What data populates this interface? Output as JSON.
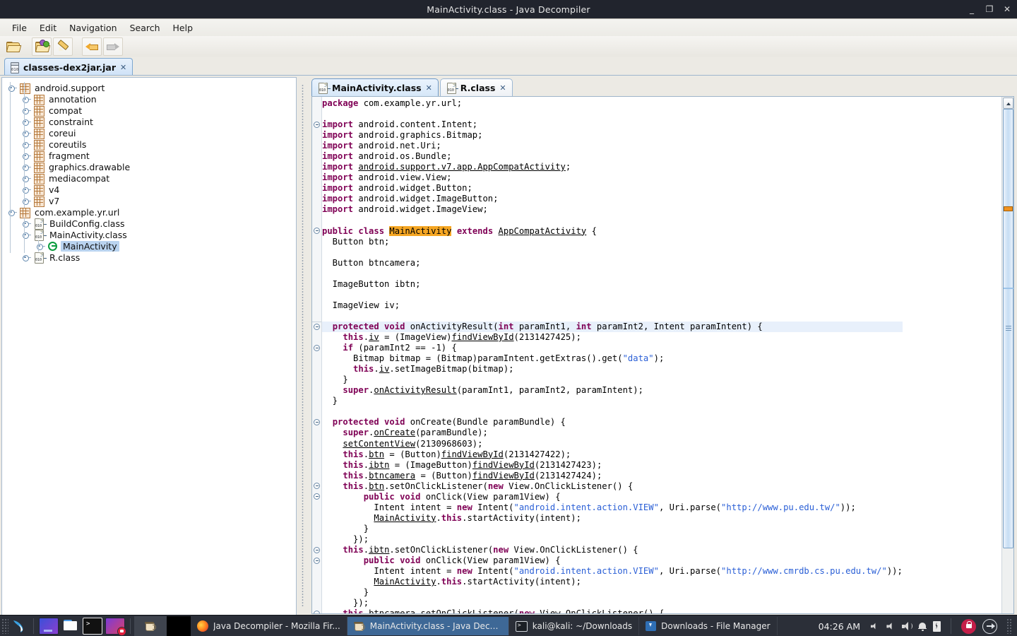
{
  "window": {
    "title": "MainActivity.class - Java Decompiler",
    "controls": [
      {
        "name": "minimize",
        "glyph": "_"
      },
      {
        "name": "maximize",
        "glyph": "❐"
      },
      {
        "name": "close",
        "glyph": "✕"
      }
    ]
  },
  "menubar": {
    "items": [
      "File",
      "Edit",
      "Navigation",
      "Search",
      "Help"
    ]
  },
  "toolbar": {
    "buttons": [
      {
        "name": "open-file-icon",
        "tooltip": "Open File"
      },
      {
        "name": "open-type-icon",
        "tooltip": "Open Type"
      },
      {
        "name": "edit-icon",
        "tooltip": "Edit"
      },
      {
        "name": "back-arrow-icon",
        "tooltip": "Back"
      },
      {
        "name": "forward-arrow-icon",
        "tooltip": "Forward"
      }
    ]
  },
  "jar_tab": {
    "label": "classes-dex2jar.jar",
    "close": "✕"
  },
  "tree": {
    "items": [
      {
        "label": "android.support",
        "indent": 0,
        "icon": "package-icon",
        "expanded": true,
        "selected": false
      },
      {
        "label": "annotation",
        "indent": 1,
        "icon": "package-icon",
        "expanded": false,
        "selected": false
      },
      {
        "label": "compat",
        "indent": 1,
        "icon": "package-icon",
        "expanded": false,
        "selected": false
      },
      {
        "label": "constraint",
        "indent": 1,
        "icon": "package-icon",
        "expanded": false,
        "selected": false
      },
      {
        "label": "coreui",
        "indent": 1,
        "icon": "package-icon",
        "expanded": false,
        "selected": false
      },
      {
        "label": "coreutils",
        "indent": 1,
        "icon": "package-icon",
        "expanded": false,
        "selected": false
      },
      {
        "label": "fragment",
        "indent": 1,
        "icon": "package-icon",
        "expanded": false,
        "selected": false
      },
      {
        "label": "graphics.drawable",
        "indent": 1,
        "icon": "package-icon",
        "expanded": false,
        "selected": false
      },
      {
        "label": "mediacompat",
        "indent": 1,
        "icon": "package-icon",
        "expanded": false,
        "selected": false
      },
      {
        "label": "v4",
        "indent": 1,
        "icon": "package-icon",
        "expanded": false,
        "selected": false
      },
      {
        "label": "v7",
        "indent": 1,
        "icon": "package-icon",
        "expanded": false,
        "selected": false
      },
      {
        "label": "com.example.yr.url",
        "indent": 0,
        "icon": "package-icon",
        "expanded": true,
        "selected": false
      },
      {
        "label": "BuildConfig.class",
        "indent": 1,
        "icon": "class-file-icon",
        "expanded": false,
        "selected": false
      },
      {
        "label": "MainActivity.class",
        "indent": 1,
        "icon": "class-file-icon",
        "expanded": true,
        "selected": false
      },
      {
        "label": "MainActivity",
        "indent": 2,
        "icon": "class-type-icon",
        "expanded": false,
        "selected": true
      },
      {
        "label": "R.class",
        "indent": 1,
        "icon": "class-file-icon",
        "expanded": false,
        "selected": false
      }
    ]
  },
  "editor": {
    "tabs": [
      {
        "label": "MainActivity.class",
        "close": "✕",
        "active": true
      },
      {
        "label": "R.class",
        "close": "✕",
        "active": false
      }
    ],
    "highlight_token": "MainActivity",
    "code_lines": [
      {
        "t": "package",
        "segs": [
          {
            "k": "kw",
            "v": "package"
          },
          {
            "v": " com.example.yr.url;"
          }
        ]
      },
      {
        "segs": []
      },
      {
        "fold": true,
        "segs": [
          {
            "k": "kw",
            "v": "import"
          },
          {
            "v": " android.content.Intent;"
          }
        ]
      },
      {
        "segs": [
          {
            "k": "kw",
            "v": "import"
          },
          {
            "v": " android.graphics.Bitmap;"
          }
        ]
      },
      {
        "segs": [
          {
            "k": "kw",
            "v": "import"
          },
          {
            "v": " android.net.Uri;"
          }
        ]
      },
      {
        "segs": [
          {
            "k": "kw",
            "v": "import"
          },
          {
            "v": " android.os.Bundle;"
          }
        ]
      },
      {
        "segs": [
          {
            "k": "kw",
            "v": "import"
          },
          {
            "v": " "
          },
          {
            "k": "und",
            "v": "android.support.v7.app.AppCompatActivity"
          },
          {
            "v": ";"
          }
        ]
      },
      {
        "segs": [
          {
            "k": "kw",
            "v": "import"
          },
          {
            "v": " android.view.View;"
          }
        ]
      },
      {
        "segs": [
          {
            "k": "kw",
            "v": "import"
          },
          {
            "v": " android.widget.Button;"
          }
        ]
      },
      {
        "segs": [
          {
            "k": "kw",
            "v": "import"
          },
          {
            "v": " android.widget.ImageButton;"
          }
        ]
      },
      {
        "segs": [
          {
            "k": "kw",
            "v": "import"
          },
          {
            "v": " android.widget.ImageView;"
          }
        ]
      },
      {
        "segs": []
      },
      {
        "fold": true,
        "segs": [
          {
            "k": "kw",
            "v": "public class"
          },
          {
            "v": " "
          },
          {
            "k": "mark",
            "v": "MainActivity"
          },
          {
            "v": " "
          },
          {
            "k": "kw",
            "v": "extends"
          },
          {
            "v": " "
          },
          {
            "k": "und",
            "v": "AppCompatActivity"
          },
          {
            "v": " {"
          }
        ]
      },
      {
        "segs": [
          {
            "v": "  Button btn;"
          }
        ]
      },
      {
        "segs": []
      },
      {
        "segs": [
          {
            "v": "  Button btncamera;"
          }
        ]
      },
      {
        "segs": []
      },
      {
        "segs": [
          {
            "v": "  ImageButton ibtn;"
          }
        ]
      },
      {
        "segs": []
      },
      {
        "segs": [
          {
            "v": "  ImageView iv;"
          }
        ]
      },
      {
        "segs": []
      },
      {
        "fold": true,
        "hl": true,
        "segs": [
          {
            "v": "  "
          },
          {
            "k": "kw",
            "v": "protected void"
          },
          {
            "v": " onActivityResult("
          },
          {
            "k": "kw",
            "v": "int"
          },
          {
            "v": " paramInt1, "
          },
          {
            "k": "kw",
            "v": "int"
          },
          {
            "v": " paramInt2, Intent paramIntent) {"
          }
        ]
      },
      {
        "segs": [
          {
            "v": "    "
          },
          {
            "k": "kw",
            "v": "this"
          },
          {
            "v": "."
          },
          {
            "k": "und",
            "v": "iv"
          },
          {
            "v": " = (ImageView)"
          },
          {
            "k": "und",
            "v": "findViewById"
          },
          {
            "v": "(2131427425);"
          }
        ]
      },
      {
        "fold": true,
        "segs": [
          {
            "v": "    "
          },
          {
            "k": "kw",
            "v": "if"
          },
          {
            "v": " (paramInt2 == -1) {"
          }
        ]
      },
      {
        "segs": [
          {
            "v": "      Bitmap bitmap = (Bitmap)paramIntent.getExtras().get("
          },
          {
            "k": "str",
            "v": "\"data\""
          },
          {
            "v": ");"
          }
        ]
      },
      {
        "segs": [
          {
            "v": "      "
          },
          {
            "k": "kw",
            "v": "this"
          },
          {
            "v": "."
          },
          {
            "k": "und",
            "v": "iv"
          },
          {
            "v": ".setImageBitmap(bitmap);"
          }
        ]
      },
      {
        "segs": [
          {
            "v": "    }"
          }
        ]
      },
      {
        "segs": [
          {
            "v": "    "
          },
          {
            "k": "kw",
            "v": "super"
          },
          {
            "v": "."
          },
          {
            "k": "und",
            "v": "onActivityResult"
          },
          {
            "v": "(paramInt1, paramInt2, paramIntent);"
          }
        ]
      },
      {
        "segs": [
          {
            "v": "  }"
          }
        ]
      },
      {
        "segs": []
      },
      {
        "fold": true,
        "segs": [
          {
            "v": "  "
          },
          {
            "k": "kw",
            "v": "protected void"
          },
          {
            "v": " onCreate(Bundle paramBundle) {"
          }
        ]
      },
      {
        "segs": [
          {
            "v": "    "
          },
          {
            "k": "kw",
            "v": "super"
          },
          {
            "v": "."
          },
          {
            "k": "und",
            "v": "onCreate"
          },
          {
            "v": "(paramBundle);"
          }
        ]
      },
      {
        "segs": [
          {
            "v": "    "
          },
          {
            "k": "und",
            "v": "setContentView"
          },
          {
            "v": "(2130968603);"
          }
        ]
      },
      {
        "segs": [
          {
            "v": "    "
          },
          {
            "k": "kw",
            "v": "this"
          },
          {
            "v": "."
          },
          {
            "k": "und",
            "v": "btn"
          },
          {
            "v": " = (Button)"
          },
          {
            "k": "und",
            "v": "findViewById"
          },
          {
            "v": "(2131427422);"
          }
        ]
      },
      {
        "segs": [
          {
            "v": "    "
          },
          {
            "k": "kw",
            "v": "this"
          },
          {
            "v": "."
          },
          {
            "k": "und",
            "v": "ibtn"
          },
          {
            "v": " = (ImageButton)"
          },
          {
            "k": "und",
            "v": "findViewById"
          },
          {
            "v": "(2131427423);"
          }
        ]
      },
      {
        "segs": [
          {
            "v": "    "
          },
          {
            "k": "kw",
            "v": "this"
          },
          {
            "v": "."
          },
          {
            "k": "und",
            "v": "btncamera"
          },
          {
            "v": " = (Button)"
          },
          {
            "k": "und",
            "v": "findViewById"
          },
          {
            "v": "(2131427424);"
          }
        ]
      },
      {
        "fold": true,
        "segs": [
          {
            "v": "    "
          },
          {
            "k": "kw",
            "v": "this"
          },
          {
            "v": "."
          },
          {
            "k": "und",
            "v": "btn"
          },
          {
            "v": ".setOnClickListener("
          },
          {
            "k": "kw",
            "v": "new"
          },
          {
            "v": " View.OnClickListener() {"
          }
        ]
      },
      {
        "fold": true,
        "segs": [
          {
            "v": "        "
          },
          {
            "k": "kw",
            "v": "public void"
          },
          {
            "v": " onClick(View param1View) {"
          }
        ]
      },
      {
        "segs": [
          {
            "v": "          Intent intent = "
          },
          {
            "k": "kw",
            "v": "new"
          },
          {
            "v": " Intent("
          },
          {
            "k": "str",
            "v": "\"android.intent.action.VIEW\""
          },
          {
            "v": ", Uri.parse("
          },
          {
            "k": "str",
            "v": "\"http://www.pu.edu.tw/\""
          },
          {
            "v": "));"
          }
        ]
      },
      {
        "segs": [
          {
            "v": "          "
          },
          {
            "k": "und",
            "v": "MainActivity"
          },
          {
            "v": "."
          },
          {
            "k": "kw",
            "v": "this"
          },
          {
            "v": ".startActivity(intent);"
          }
        ]
      },
      {
        "segs": [
          {
            "v": "        }"
          }
        ]
      },
      {
        "segs": [
          {
            "v": "      });"
          }
        ]
      },
      {
        "fold": true,
        "segs": [
          {
            "v": "    "
          },
          {
            "k": "kw",
            "v": "this"
          },
          {
            "v": "."
          },
          {
            "k": "und",
            "v": "ibtn"
          },
          {
            "v": ".setOnClickListener("
          },
          {
            "k": "kw",
            "v": "new"
          },
          {
            "v": " View.OnClickListener() {"
          }
        ]
      },
      {
        "fold": true,
        "segs": [
          {
            "v": "        "
          },
          {
            "k": "kw",
            "v": "public void"
          },
          {
            "v": " onClick(View param1View) {"
          }
        ]
      },
      {
        "segs": [
          {
            "v": "          Intent intent = "
          },
          {
            "k": "kw",
            "v": "new"
          },
          {
            "v": " Intent("
          },
          {
            "k": "str",
            "v": "\"android.intent.action.VIEW\""
          },
          {
            "v": ", Uri.parse("
          },
          {
            "k": "str",
            "v": "\"http://www.cmrdb.cs.pu.edu.tw/\""
          },
          {
            "v": "));"
          }
        ]
      },
      {
        "segs": [
          {
            "v": "          "
          },
          {
            "k": "und",
            "v": "MainActivity"
          },
          {
            "v": "."
          },
          {
            "k": "kw",
            "v": "this"
          },
          {
            "v": ".startActivity(intent);"
          }
        ]
      },
      {
        "segs": [
          {
            "v": "        }"
          }
        ]
      },
      {
        "segs": [
          {
            "v": "      });"
          }
        ]
      },
      {
        "fold": true,
        "segs": [
          {
            "v": "    "
          },
          {
            "k": "kw",
            "v": "this"
          },
          {
            "v": "."
          },
          {
            "k": "und",
            "v": "btncamera"
          },
          {
            "v": ".setOnClickListener("
          },
          {
            "k": "kw",
            "v": "new"
          },
          {
            "v": " View.OnClickListener() {"
          }
        ]
      }
    ]
  },
  "taskbar": {
    "launchers": [
      {
        "name": "kali-menu-icon"
      },
      {
        "name": "workspace-switcher-icon"
      },
      {
        "name": "file-manager-launcher-icon"
      },
      {
        "name": "terminal-launcher-icon"
      },
      {
        "name": "screen-recorder-launcher-icon"
      }
    ],
    "windows": [
      {
        "label": "Java Decompiler - Mozilla Fir...",
        "icon": "firefox-icon",
        "active": false
      },
      {
        "label": "MainActivity.class - Java Deco...",
        "icon": "java-cup-icon",
        "active": true
      },
      {
        "label": "kali@kali: ~/Downloads",
        "icon": "terminal-icon",
        "active": false
      },
      {
        "label": "Downloads - File Manager",
        "icon": "file-manager-icon",
        "active": false
      }
    ],
    "clock": "04:26 AM",
    "tray": [
      {
        "name": "volume-mute-icon"
      },
      {
        "name": "volume-low-icon"
      },
      {
        "name": "volume-icon"
      },
      {
        "name": "notification-bell-icon"
      },
      {
        "name": "battery-icon"
      },
      {
        "name": "lock-screen-icon"
      },
      {
        "name": "power-icon"
      }
    ]
  },
  "colors": {
    "titlebar_bg": "#21242d",
    "taskbar_bg": "#2b2f38",
    "accent_tab": "#cfe2f7",
    "keyword": "#7f0055",
    "string": "#2a5fd6",
    "highlight": "#f5a623",
    "selection": "#b9d3ef",
    "active_task": "#3e6896"
  }
}
